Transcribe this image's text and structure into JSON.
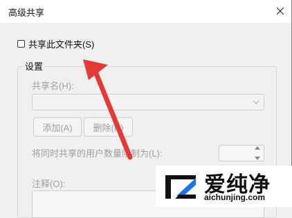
{
  "window": {
    "title": "高级共享",
    "close_icon": "close-icon"
  },
  "share_checkbox": {
    "label": "共享此文件夹(S)",
    "checked": false
  },
  "settings_group": {
    "label": "设置",
    "share_name_label": "共享名(H):",
    "share_name_value": "",
    "add_button": "添加(A)",
    "delete_button": "删除(R)",
    "limit_label": "将同时共享的用户数量限制为(L):",
    "limit_value": "",
    "note_label": "注释(O):",
    "note_value": ""
  },
  "annotation": {
    "arrow_color": "#e53935"
  },
  "watermark": {
    "brand_text": "爱纯净",
    "url_text": "aichunjing.com",
    "accent_color": "#1a73e8"
  }
}
